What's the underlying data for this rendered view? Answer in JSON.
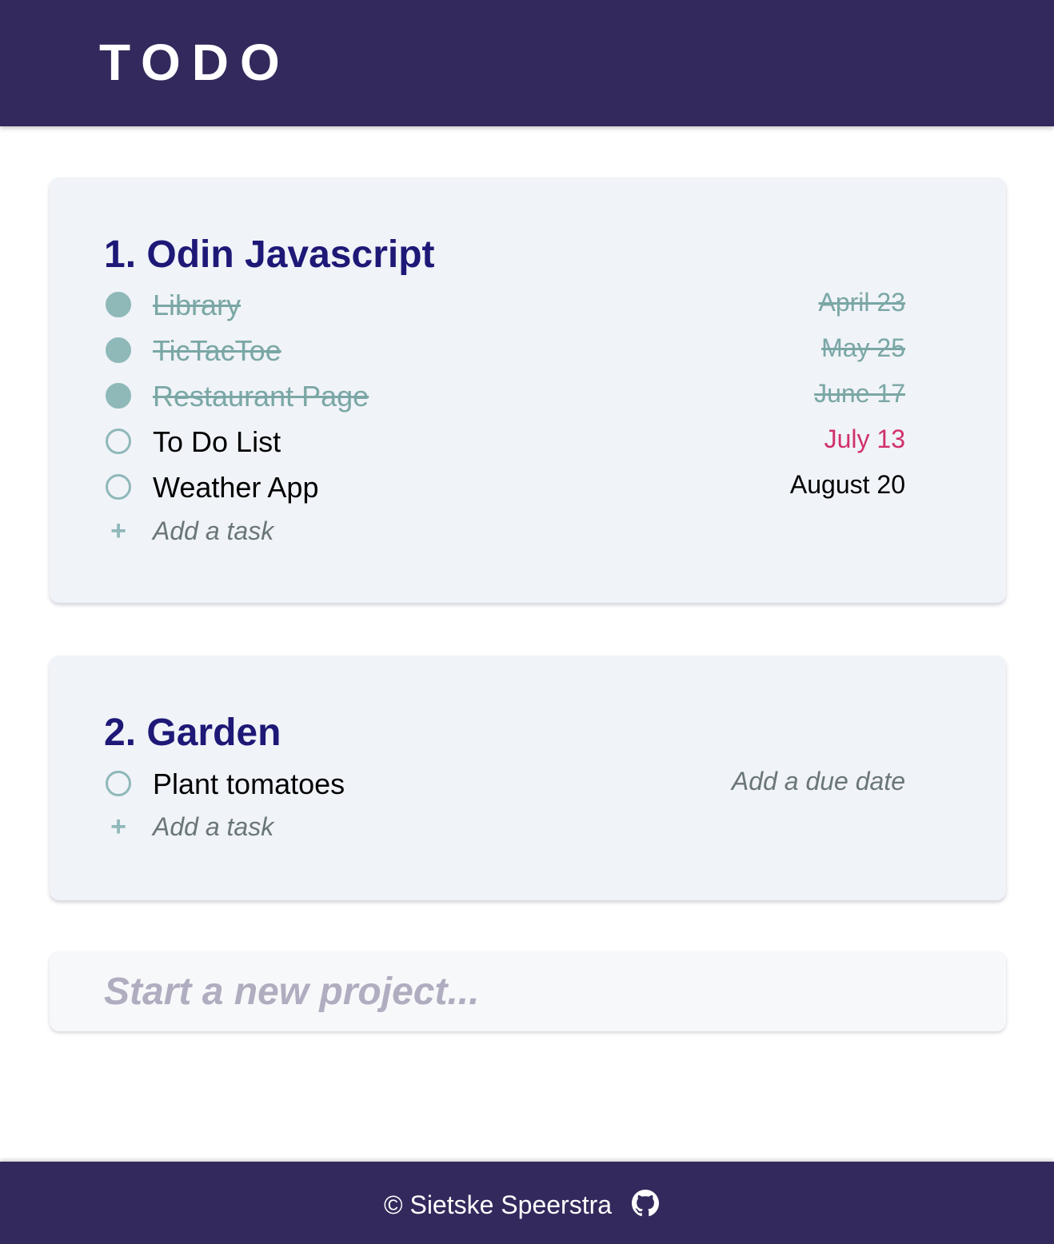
{
  "header": {
    "title": "TODO"
  },
  "projects": [
    {
      "title": "1. Odin Javascript",
      "tasks": [
        {
          "name": "Library",
          "date": "April 23",
          "done": true
        },
        {
          "name": "TicTacToe",
          "date": "May 25",
          "done": true
        },
        {
          "name": "Restaurant Page",
          "date": "June 17",
          "done": true
        },
        {
          "name": "To Do List",
          "date": "July 13",
          "done": false
        },
        {
          "name": "Weather App",
          "date": "August 20",
          "done": false
        }
      ],
      "add_task_label": "Add a task"
    },
    {
      "title": "2. Garden",
      "tasks": [
        {
          "name": "Plant tomatoes",
          "date": "Add a due date",
          "done": false
        }
      ],
      "add_task_label": "Add a task"
    }
  ],
  "new_project": {
    "placeholder": "Start a new project..."
  },
  "footer": {
    "copyright": "© Sietske Speerstra",
    "icon": "github-icon"
  },
  "colors": {
    "header_bg": "#33295c",
    "title": "#1e1877",
    "done": "#7aa7a5",
    "check": "#8fb8b9",
    "overdue": "#d1306f",
    "card_bg": "#f0f3f8"
  }
}
